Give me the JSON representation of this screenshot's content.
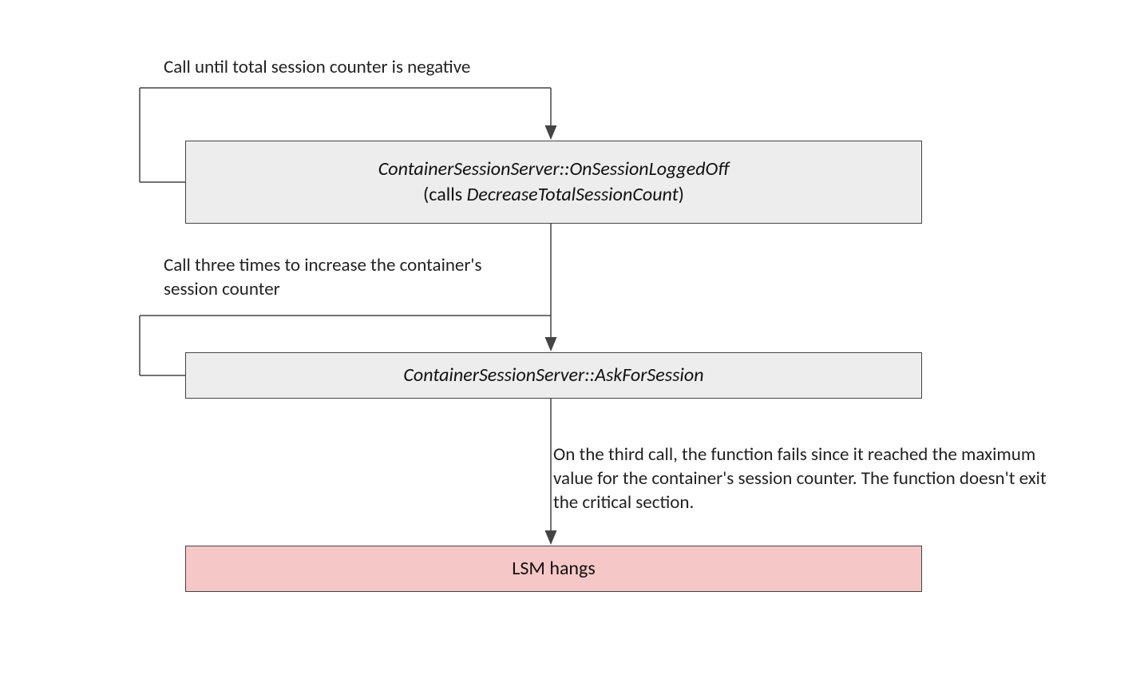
{
  "labels": {
    "top": "Call until total session counter is negative",
    "middle": "Call three times to increase the container's session counter",
    "bottom": "On the third call, the function fails since it reached the maximum value for the container's session counter. The function doesn't exit the critical section."
  },
  "boxes": {
    "box1_line1": "ContainerSessionServer::OnSessionLoggedOff",
    "box1_line2a": "(calls ",
    "box1_line2b": "DecreaseTotalSessionCount",
    "box1_line2c": ")",
    "box2": "ContainerSessionServer::AskForSession",
    "box3": "LSM hangs"
  },
  "colors": {
    "grey": "#ededed",
    "pink": "#f6c7c7",
    "stroke": "#444444"
  }
}
